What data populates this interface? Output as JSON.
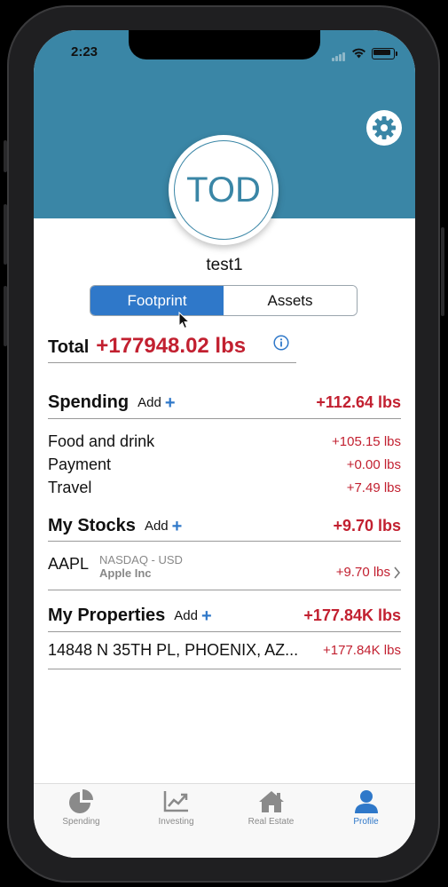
{
  "status_bar": {
    "time": "2:23"
  },
  "profile": {
    "initials": "TOD",
    "username": "test1"
  },
  "segmented": {
    "options": [
      "Footprint",
      "Assets"
    ],
    "selected": "Footprint"
  },
  "total": {
    "label": "Total",
    "value": "+177948.02 lbs"
  },
  "spending": {
    "title": "Spending",
    "add_label": "Add",
    "total": "+112.64 lbs",
    "items": [
      {
        "label": "Food and drink",
        "value": "+105.15 lbs"
      },
      {
        "label": "Payment",
        "value": "+0.00 lbs"
      },
      {
        "label": "Travel",
        "value": "+7.49 lbs"
      }
    ]
  },
  "stocks": {
    "title": "My Stocks",
    "add_label": "Add",
    "total": "+9.70 lbs",
    "items": [
      {
        "ticker": "AAPL",
        "exchange": "NASDAQ - USD",
        "name": "Apple Inc",
        "value": "+9.70 lbs"
      }
    ]
  },
  "properties": {
    "title": "My Properties",
    "add_label": "Add",
    "total": "+177.84K lbs",
    "items": [
      {
        "address": "14848 N 35TH PL, PHOENIX, AZ...",
        "value": "+177.84K lbs"
      }
    ]
  },
  "tabbar": {
    "tabs": [
      {
        "label": "Spending",
        "icon": "pie-chart-icon"
      },
      {
        "label": "Investing",
        "icon": "trend-chart-icon"
      },
      {
        "label": "Real Estate",
        "icon": "house-icon"
      },
      {
        "label": "Profile",
        "icon": "person-icon"
      }
    ],
    "active": "Profile"
  },
  "colors": {
    "header": "#3a86a6",
    "accent": "#2f78c9",
    "negative": "#c22030"
  }
}
